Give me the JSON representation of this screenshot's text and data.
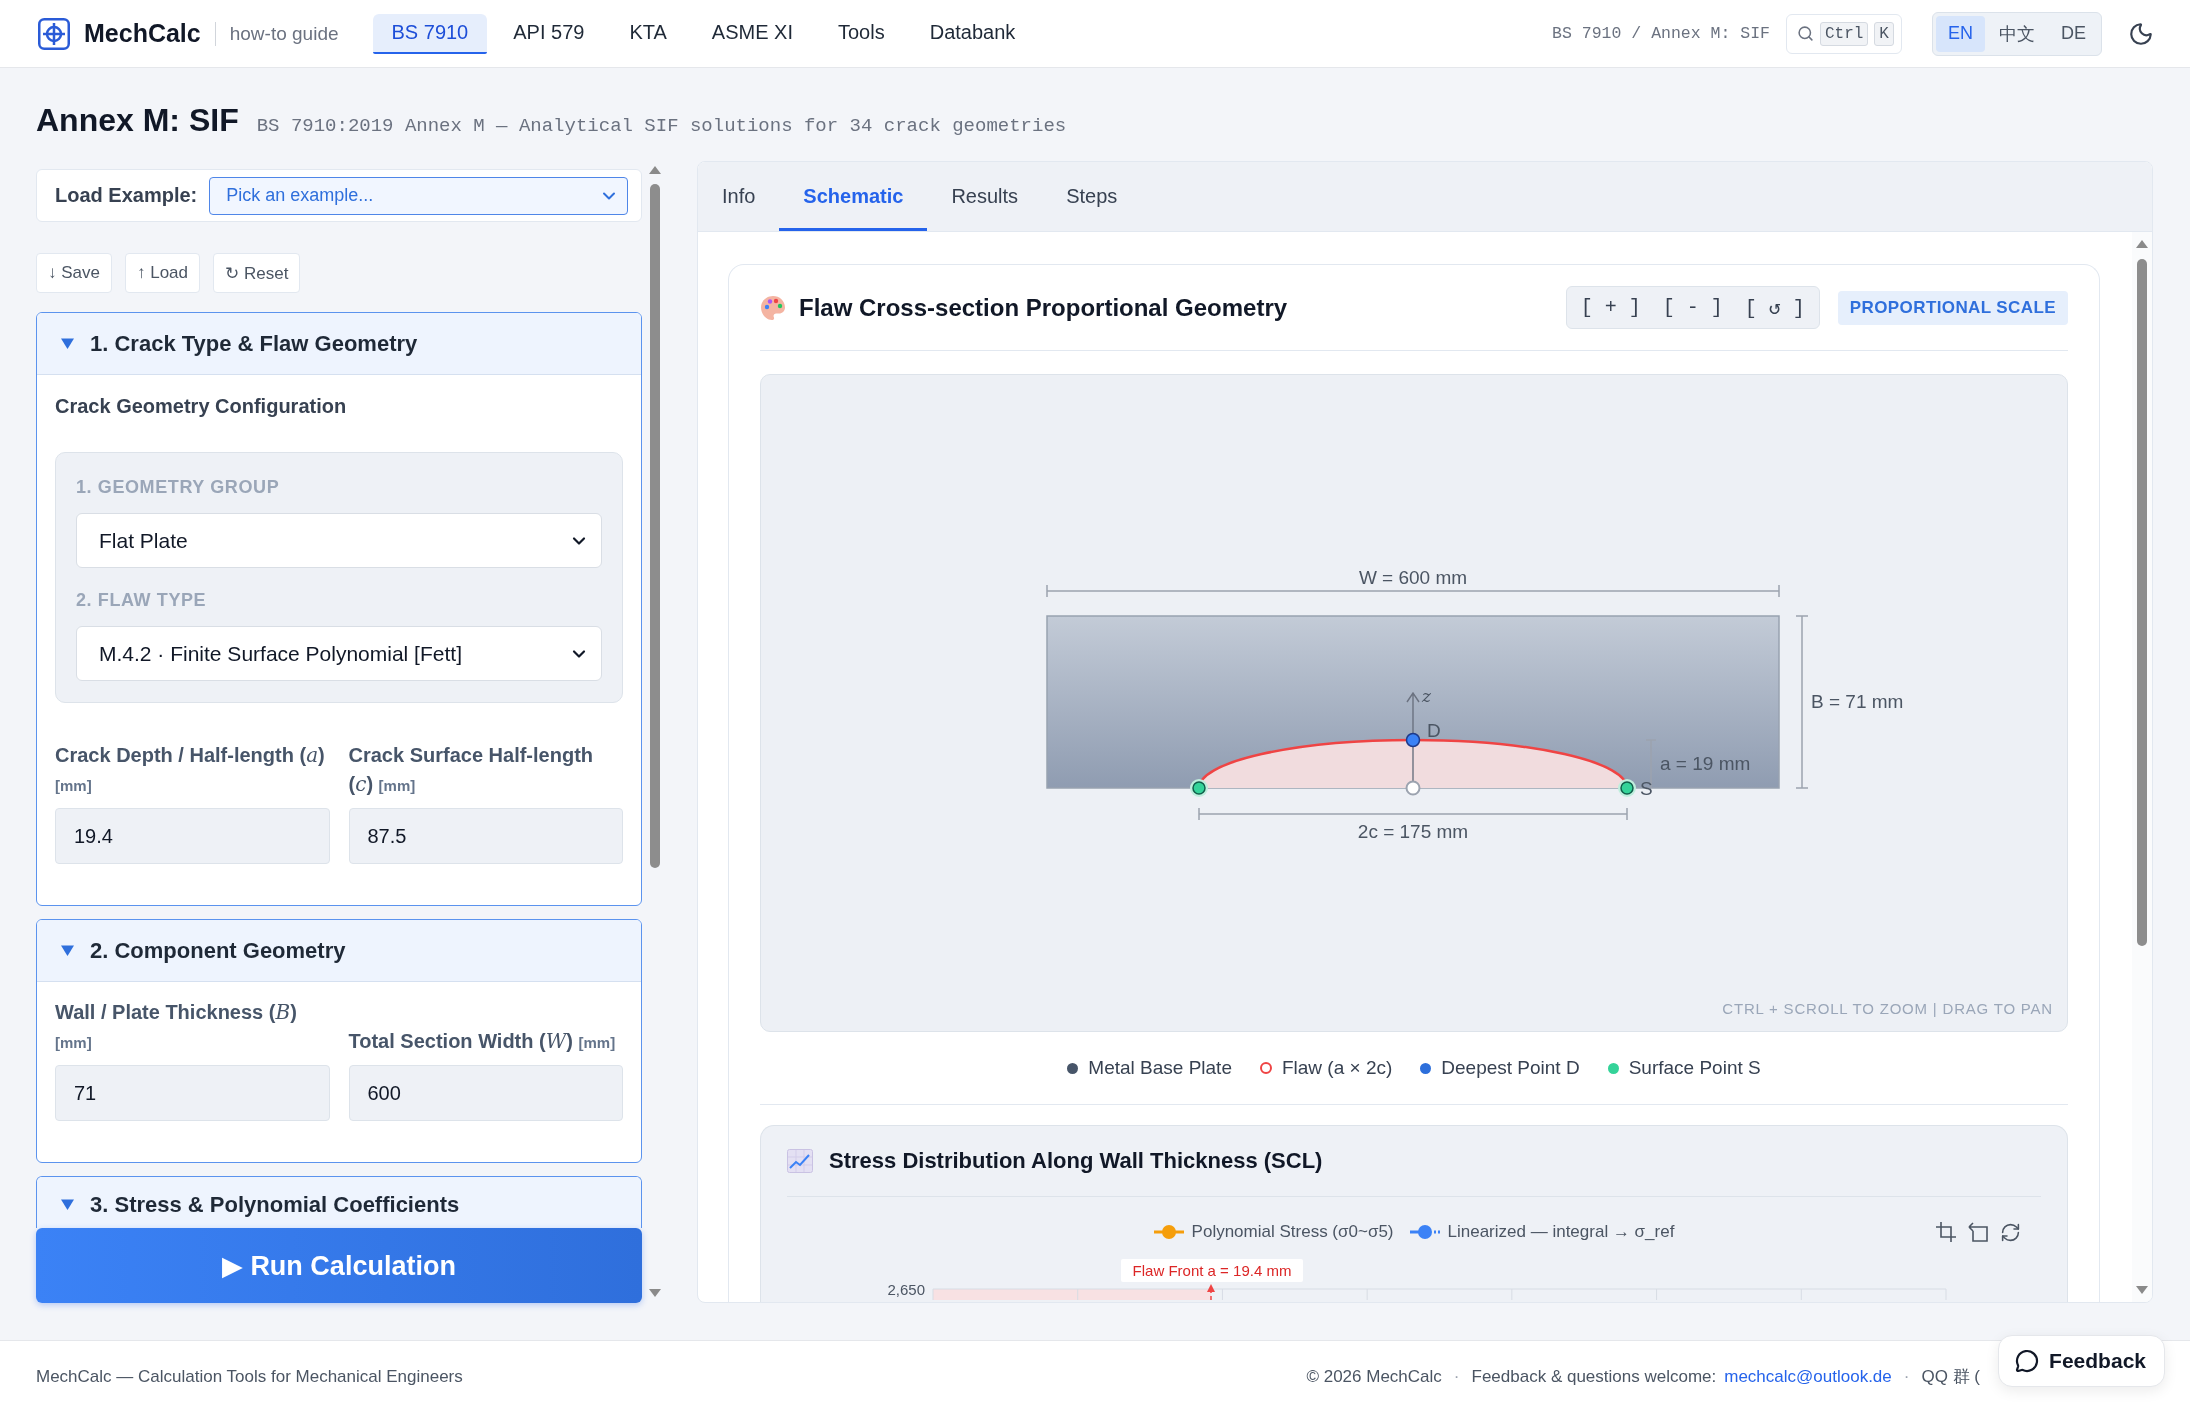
{
  "header": {
    "brand": "MechCalc",
    "guide_link": "how-to guide",
    "nav": [
      {
        "label": "BS 7910",
        "selected": true
      },
      {
        "label": "API 579",
        "selected": false
      },
      {
        "label": "KTA",
        "selected": false
      },
      {
        "label": "ASME XI",
        "selected": false
      },
      {
        "label": "Tools",
        "selected": false
      },
      {
        "label": "Databank",
        "selected": false
      }
    ],
    "breadcrumb": "BS 7910 / Annex M: SIF",
    "search_keys": [
      "Ctrl",
      "K"
    ],
    "languages": [
      {
        "label": "EN",
        "selected": true
      },
      {
        "label": "中文",
        "selected": false
      },
      {
        "label": "DE",
        "selected": false
      }
    ]
  },
  "page": {
    "title": "Annex M: SIF",
    "subtitle": "BS 7910:2019 Annex M — Analytical SIF solutions for 34 crack geometries"
  },
  "sidebar": {
    "load_example": {
      "label": "Load Example:",
      "placeholder": "Pick an example..."
    },
    "file_buttons": [
      "↓ Save",
      "↑ Load",
      "↻ Reset"
    ],
    "sections": [
      {
        "title": "1. Crack Type & Flaw Geometry",
        "expanded": true,
        "heading": "Crack Geometry Configuration",
        "selectors": [
          {
            "label": "1. GEOMETRY GROUP",
            "value": "Flat Plate"
          },
          {
            "label": "2. FLAW TYPE",
            "value": "M.4.2 · Finite Surface Polynomial [Fett]"
          }
        ],
        "fields": [
          {
            "label": "Crack Depth / Half-length (*a*)",
            "unit": "[mm]",
            "value": "19.4"
          },
          {
            "label": "Crack Surface Half-length (*c*)",
            "unit": "[mm]",
            "value": "87.5"
          }
        ]
      },
      {
        "title": "2. Component Geometry",
        "expanded": true,
        "fields": [
          {
            "label": "Wall / Plate Thickness (*B*)",
            "unit": "[mm]",
            "value": "71"
          },
          {
            "label": "Total Section Width (*W*)",
            "unit": "[mm]",
            "value": "600"
          }
        ]
      },
      {
        "title": "3. Stress & Polynomial Coefficients",
        "expanded": true
      }
    ],
    "run_button": "▶ Run Calculation"
  },
  "main": {
    "tabs": [
      {
        "label": "Info",
        "selected": false
      },
      {
        "label": "Schematic",
        "selected": true
      },
      {
        "label": "Results",
        "selected": false
      },
      {
        "label": "Steps",
        "selected": false
      }
    ],
    "geometry_card": {
      "title": "Flaw Cross-section Proportional Geometry",
      "zoom_controls": [
        "[ + ]",
        "[ - ]",
        "[ ↺ ]"
      ],
      "badge": "PROPORTIONAL SCALE",
      "dimensions": {
        "width": "W = 600 mm",
        "thickness": "B = 71 mm",
        "depth": "a = 19 mm",
        "length": "2c = 175 mm"
      },
      "axis": "z",
      "points": {
        "deepest": "D",
        "surface": "S"
      },
      "hint": "CTRL + SCROLL TO ZOOM | DRAG TO PAN",
      "legend": [
        {
          "label": "Metal Base Plate",
          "kind": "dot",
          "color": "#475569"
        },
        {
          "label": "Flaw (a × 2c)",
          "kind": "ring",
          "color": "#ef4444"
        },
        {
          "label": "Deepest Point D",
          "kind": "dot",
          "color": "#2d6fdb"
        },
        {
          "label": "Surface Point S",
          "kind": "dot",
          "color": "#34d399"
        }
      ]
    },
    "stress_card": {
      "title": "Stress Distribution Along Wall Thickness (SCL)",
      "series": [
        {
          "name": "Polynomial Stress (σ0~σ5)",
          "color": "#f59e0b"
        },
        {
          "name": "Linearized — integral → σ_ref",
          "color": "#3b82f6"
        }
      ],
      "annotation": "Flaw Front a = 19.4 mm",
      "axis_value": "2,650"
    }
  },
  "footer": {
    "tagline": "MechCalc — Calculation Tools for Mechanical Engineers",
    "items": [
      {
        "kind": "text",
        "text": "© 2026 MechCalc"
      },
      {
        "kind": "separator",
        "text": "·"
      },
      {
        "kind": "text",
        "text": "Feedback & questions welcome:"
      },
      {
        "kind": "link",
        "text": "mechcalc@outlook.de"
      },
      {
        "kind": "separator",
        "text": "·"
      },
      {
        "kind": "text",
        "text": "QQ 群 ("
      }
    ]
  },
  "feedback_button": "Feedback"
}
